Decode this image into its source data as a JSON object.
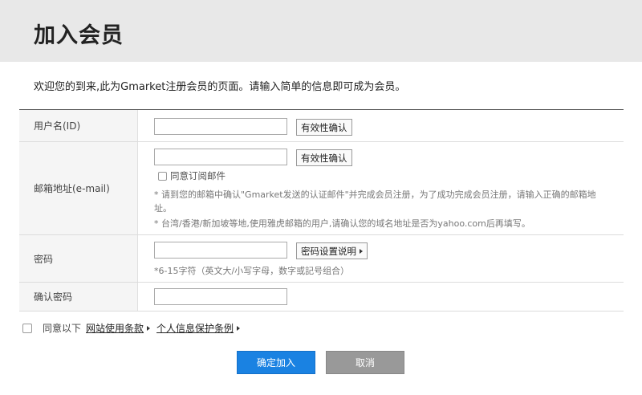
{
  "header": {
    "title": "加入会员"
  },
  "intro": "欢迎您的到来,此为Gmarket注册会员的页面。请输入简单的信息即可成为会员。",
  "form": {
    "user_id": {
      "label": "用户名(ID)",
      "value": "",
      "check_button": "有效性确认"
    },
    "email": {
      "label": "邮箱地址(e-mail)",
      "value": "",
      "check_button": "有效性确认",
      "subscribe_label": "同意订阅邮件",
      "note1": "* 请到您的邮箱中确认\"Gmarket发送的认证邮件\"并完成会员注册，为了成功完成会员注册，请输入正确的邮箱地址。",
      "note2": "* 台湾/香港/新加坡等地,使用雅虎邮箱的用户,请确认您的域名地址是否为yahoo.com后再填写。"
    },
    "password": {
      "label": "密码",
      "value": "",
      "rules_button": "密码设置说明",
      "hint": "*6-15字符（英文大/小写字母，数字或記号组合）"
    },
    "confirm_password": {
      "label": "确认密码",
      "value": ""
    }
  },
  "agreement": {
    "prefix": "同意以下",
    "terms_link": "网站使用条款",
    "privacy_link": "个人信息保护条例"
  },
  "actions": {
    "submit": "确定加入",
    "cancel": "取消"
  },
  "colors": {
    "primary": "#1a82e2",
    "cancel": "#999999",
    "header_bg": "#e8e8e8"
  }
}
